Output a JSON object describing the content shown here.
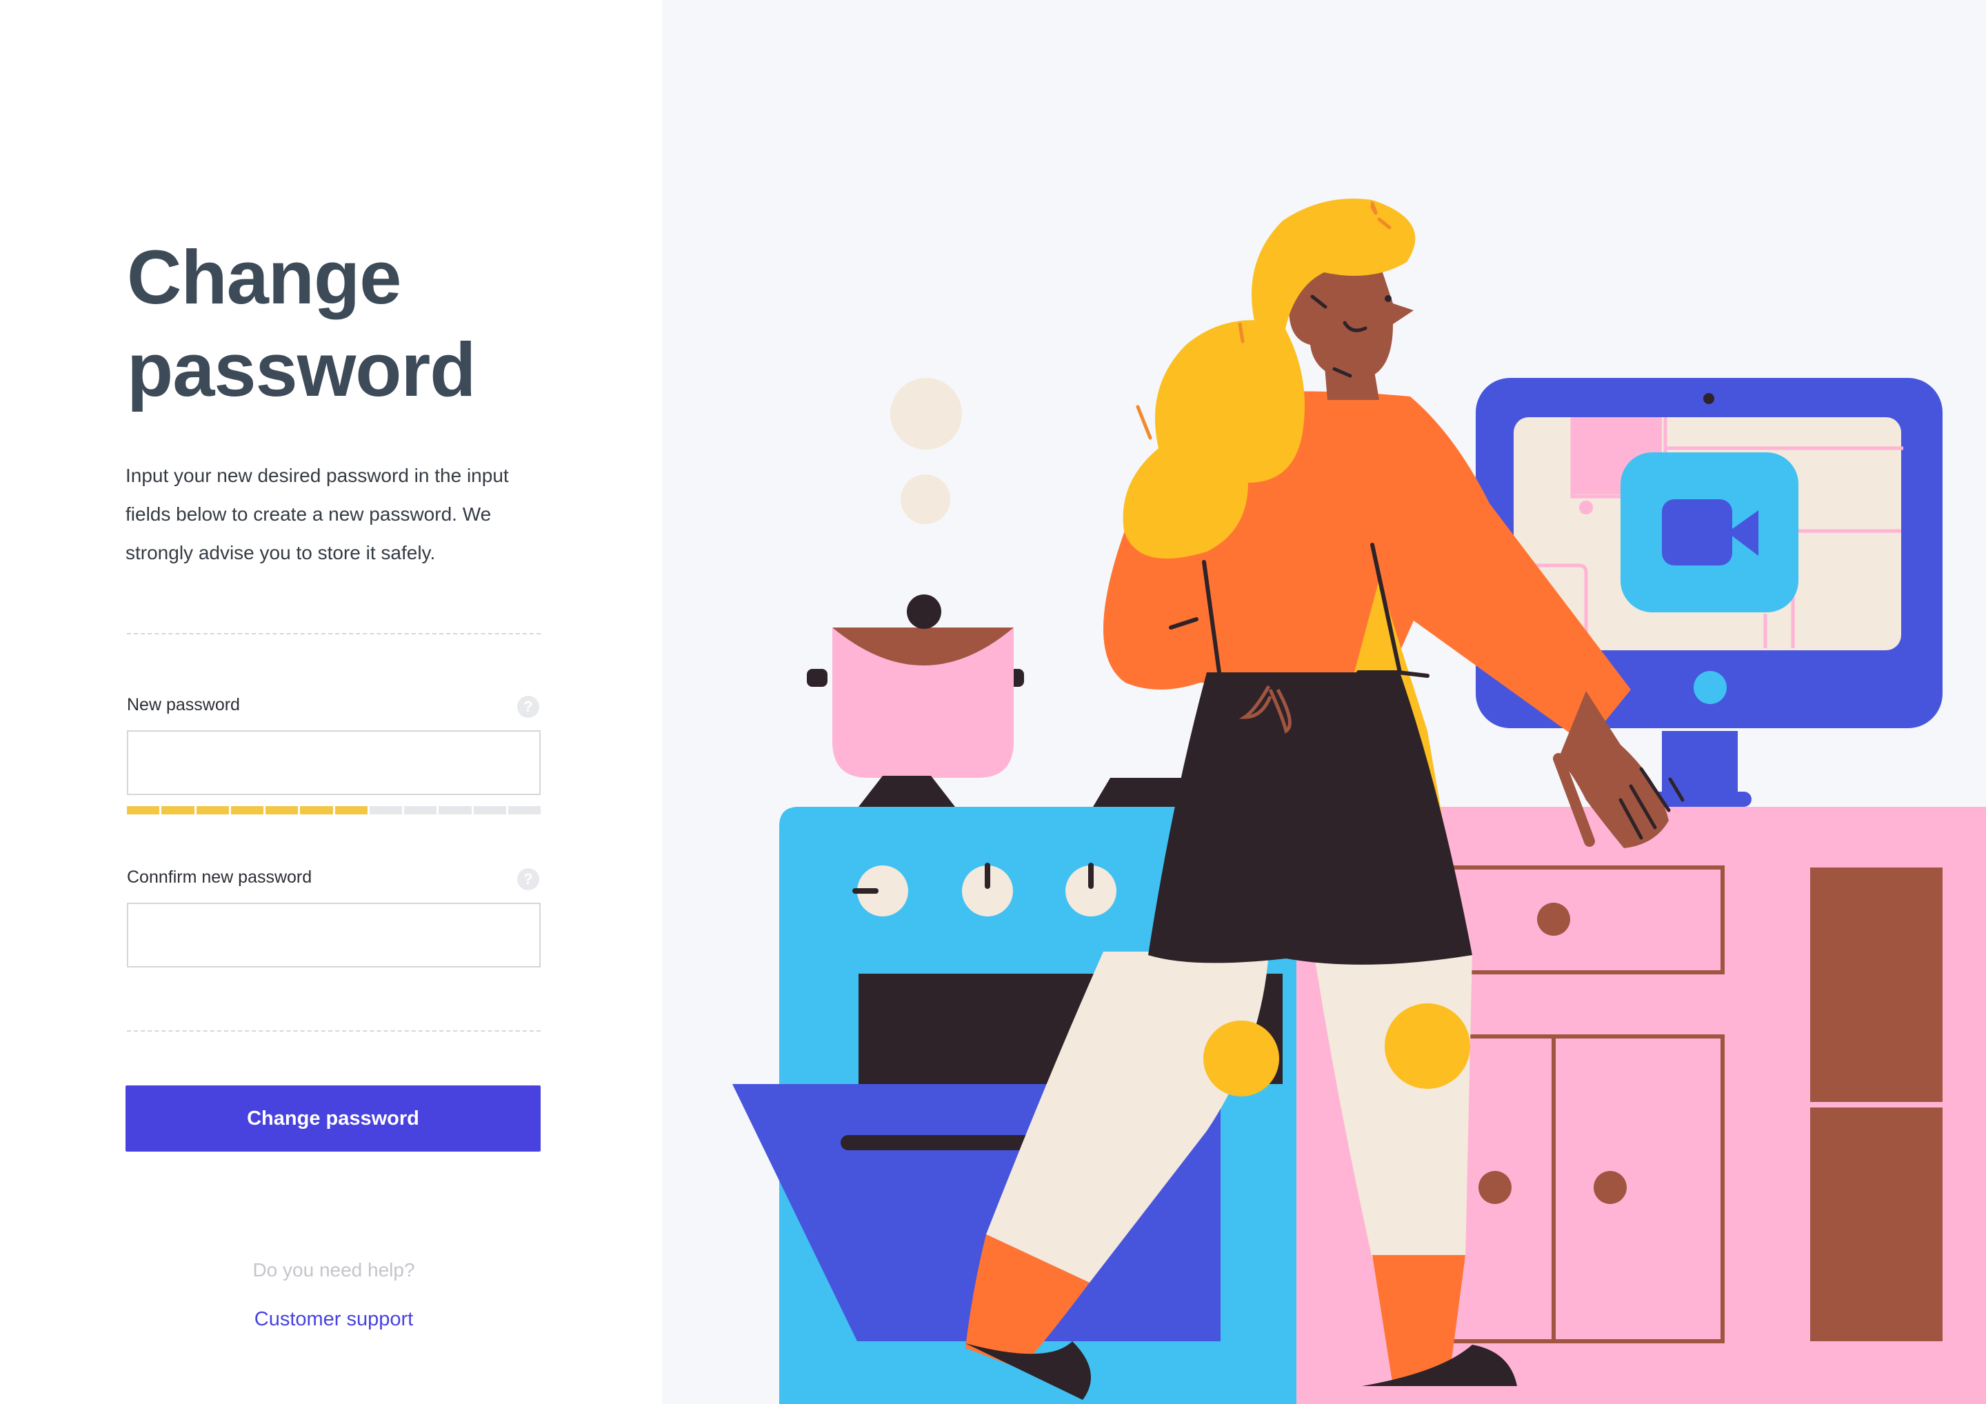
{
  "page": {
    "title_line1": "Change",
    "title_line2": "password",
    "description": "Input your new desired password in the input fields below to create a new password. We strongly advise you to store it safely."
  },
  "form": {
    "new_password": {
      "label": "New password",
      "value": "",
      "help_icon": "question-mark"
    },
    "confirm_password": {
      "label": "Connfirm new password",
      "value": "",
      "help_icon": "question-mark"
    },
    "strength": {
      "filled_segments": 7,
      "total_segments": 12,
      "color": "#f3c744"
    },
    "submit_label": "Change password"
  },
  "help": {
    "question": "Do you need help?",
    "link_label": "Customer support"
  },
  "colors": {
    "accent": "#4842de",
    "title": "#3d4a58",
    "illustration_background": "#f6f7fb"
  }
}
